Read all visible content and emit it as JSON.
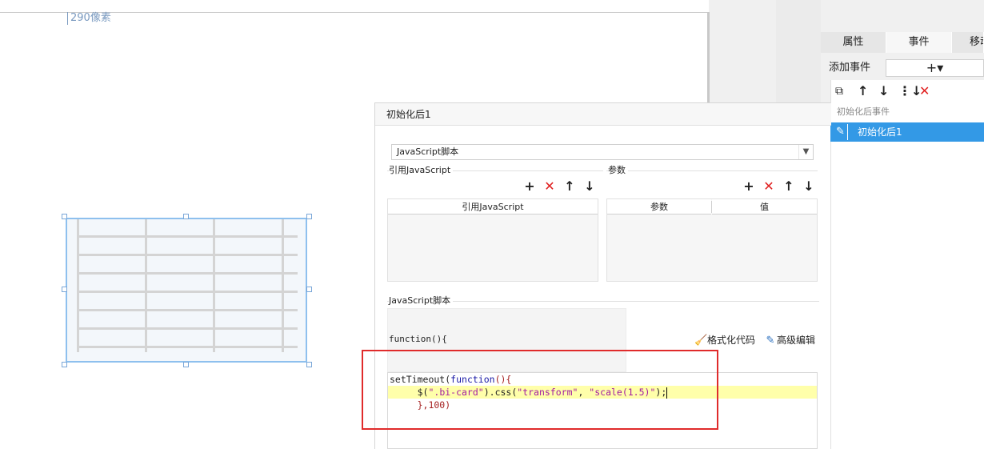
{
  "canvas": {
    "ruler_text": "290像素"
  },
  "right_panel": {
    "tabs": [
      "属性",
      "事件",
      "移动"
    ],
    "add_event_label": "添加事件",
    "add_event_button": "+▾",
    "toolbar_icons": [
      "copy-icon",
      "arrow-up-icon",
      "arrow-down-icon",
      "move-to-bottom-icon",
      "delete-icon"
    ],
    "group_label": "初始化后事件",
    "event_item": "初始化后1"
  },
  "dialog": {
    "title": "初始化后1",
    "type_select": "JavaScript脚本",
    "ref_js_label": "引用JavaScript",
    "params_label": "参数",
    "ref_js_column": "引用JavaScript",
    "params_columns": [
      "参数",
      "值"
    ],
    "script_label": "JavaScript脚本",
    "func_head": "function(){",
    "format_button": "格式化代码",
    "advanced_button": "高级编辑",
    "code": {
      "line1_a": "setTimeout(",
      "line1_kw": "function",
      "line1_b": "(){",
      "line2_a": "     $(",
      "line2_s1": "\".bi-card\"",
      "line2_b": ").css(",
      "line2_s2": "\"transform\"",
      "line2_c": ", ",
      "line2_s3": "\"scale(1.5)\"",
      "line2_d": ");",
      "line3": "     },100)"
    }
  },
  "colors": {
    "accent": "#3399e6",
    "highlight_red": "#e02b2b",
    "delete_red": "#e02020",
    "code_line_highlight": "#ffffaa"
  }
}
